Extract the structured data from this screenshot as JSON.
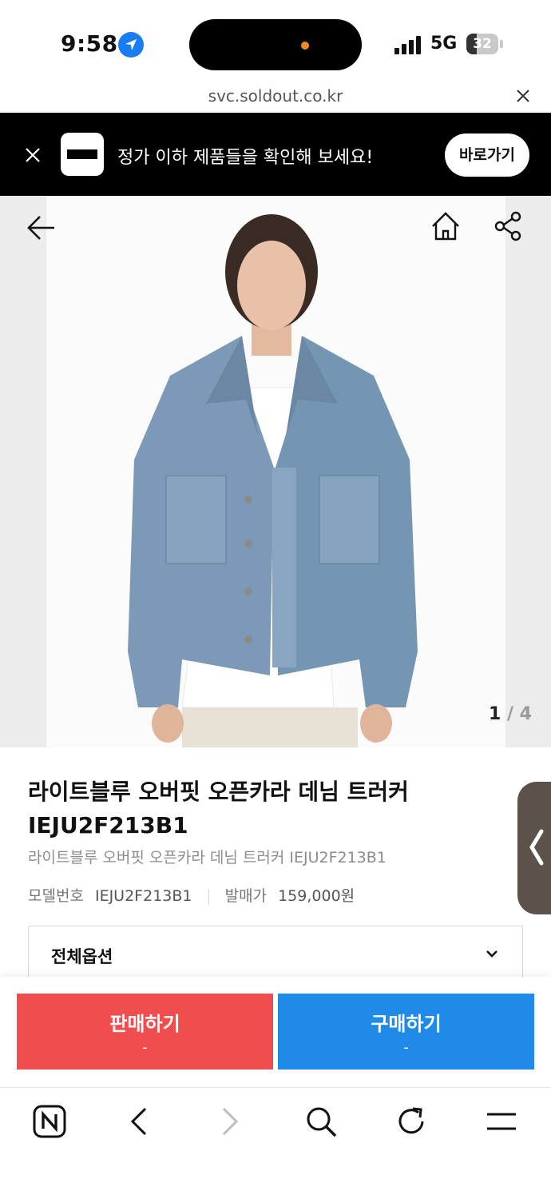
{
  "status_bar": {
    "time": "9:58",
    "network": "5G",
    "battery": "32",
    "battery_level": 0.32
  },
  "browser": {
    "url": "svc.soldout.co.kr"
  },
  "promo": {
    "text": "정가 이하 제품들을 확인해 보세요!",
    "button_label": "바로가기"
  },
  "gallery": {
    "current": "1",
    "separator": " / ",
    "total": "4"
  },
  "product": {
    "title": "라이트블루 오버핏 오픈카라 데님 트러커 IEJU2F213B1",
    "subtitle": "라이트블루 오버핏 오픈카라 데님 트러커 IEJU2F213B1",
    "model_label": "모델번호",
    "model_number": "IEJU2F213B1",
    "price_label": "발매가",
    "release_price": "159,000원",
    "option_label": "전체옵션"
  },
  "actions": {
    "sell_label": "판매하기",
    "sell_sub": "-",
    "buy_label": "구매하기",
    "buy_sub": "-"
  },
  "colors": {
    "sell": "#ef4d4e",
    "buy": "#1f8ae8",
    "banner": "#000000"
  },
  "icons": [
    "location-icon",
    "close-icon",
    "back-arrow-icon",
    "home-icon",
    "share-icon",
    "chevron-down-icon",
    "naver-icon",
    "back-icon",
    "forward-icon",
    "search-icon",
    "refresh-icon",
    "menu-icon"
  ]
}
